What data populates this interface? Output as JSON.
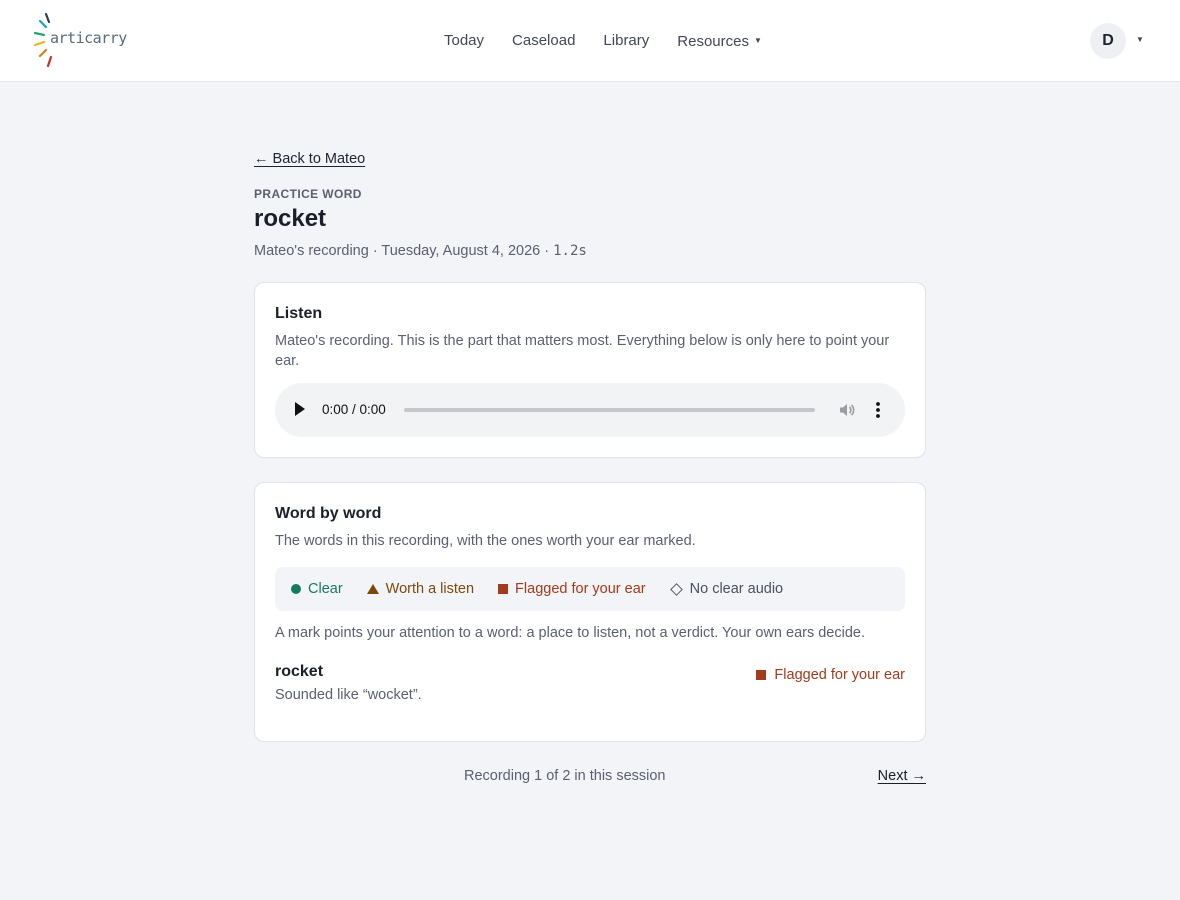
{
  "header": {
    "logo_text": "articarry",
    "nav": [
      {
        "label": "Today"
      },
      {
        "label": "Caseload"
      },
      {
        "label": "Library"
      },
      {
        "label": "Resources",
        "has_dropdown": true
      }
    ],
    "avatar_initial": "D"
  },
  "page": {
    "back_link": "← Back to Mateo",
    "eyebrow": "PRACTICE WORD",
    "title": "rocket",
    "meta_prefix": "Mateo's recording · Tuesday, August 4, 2026 · ",
    "meta_duration": "1.2s"
  },
  "listen": {
    "heading": "Listen",
    "description": "Mateo's recording. This is the part that matters most. Everything below is only here to point your ear.",
    "player_time": "0:00 / 0:00"
  },
  "word_by_word": {
    "heading": "Word by word",
    "description": "The words in this recording, with the ones worth your ear marked.",
    "legend": [
      {
        "label": "Clear",
        "icon": "circle-icon",
        "color": "#17795f"
      },
      {
        "label": "Worth a listen",
        "icon": "triangle-icon",
        "color": "#7a4a0a"
      },
      {
        "label": "Flagged for your ear",
        "icon": "square-icon",
        "color": "#a33a1c"
      },
      {
        "label": "No clear audio",
        "icon": "diamond-icon",
        "color": "#4a505c"
      }
    ],
    "note": "A mark points your attention to a word: a place to listen, not a verdict. Your own ears decide.",
    "words": [
      {
        "word": "rocket",
        "detail": "Sounded like “wocket”.",
        "status": "Flagged for your ear"
      }
    ]
  },
  "footer": {
    "counter": "Recording 1 of 2 in this session",
    "next_label": "Next →"
  }
}
